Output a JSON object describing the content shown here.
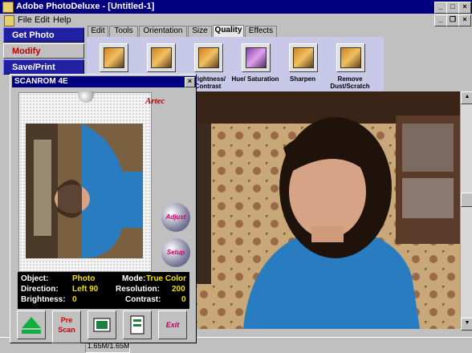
{
  "window": {
    "title": "Adobe PhotoDeluxe - [Untitled-1]"
  },
  "menu": {
    "items": [
      "File",
      "Edit",
      "Help"
    ]
  },
  "sidebar": {
    "buttons": [
      "Get Photo",
      "Modify",
      "Save/Print"
    ]
  },
  "tabs": [
    {
      "label": "Edit",
      "active": false
    },
    {
      "label": "Tools",
      "active": false
    },
    {
      "label": "Orientation",
      "active": false
    },
    {
      "label": "Size",
      "active": false
    },
    {
      "label": "Quality",
      "active": true
    },
    {
      "label": "Effects",
      "active": false
    }
  ],
  "tools": [
    {
      "label": "",
      "icon": "quality-icon"
    },
    {
      "label": "",
      "icon": "quality-icon"
    },
    {
      "label": "Brightness/ Contrast",
      "icon": "brightness-icon"
    },
    {
      "label": "Hue/ Saturation",
      "icon": "hue-icon"
    },
    {
      "label": "Sharpen",
      "icon": "sharpen-icon"
    },
    {
      "label": "Remove Dust/Scratch",
      "icon": "dust-icon"
    }
  ],
  "scanner": {
    "title": "SCANROM 4E",
    "brand": "Artec",
    "adjust_label": "Adjust",
    "setup_label": "Setup",
    "info": {
      "object_label": "Object:",
      "object_value": "Photo",
      "mode_label": "Mode:",
      "mode_value": "True Color",
      "direction_label": "Direction:",
      "direction_value": "Left 90",
      "resolution_label": "Resolution:",
      "resolution_value": "200",
      "brightness_label": "Brightness:",
      "brightness_value": "0",
      "contrast_label": "Contrast:",
      "contrast_value": "0"
    },
    "prescan_label": "Pre Scan",
    "exit_label": "Exit"
  },
  "status": {
    "memory": "1.65M/1.65M"
  },
  "colors": {
    "title_bar": "#000080",
    "sidebar": "#000080",
    "modify_text": "#c00000"
  }
}
